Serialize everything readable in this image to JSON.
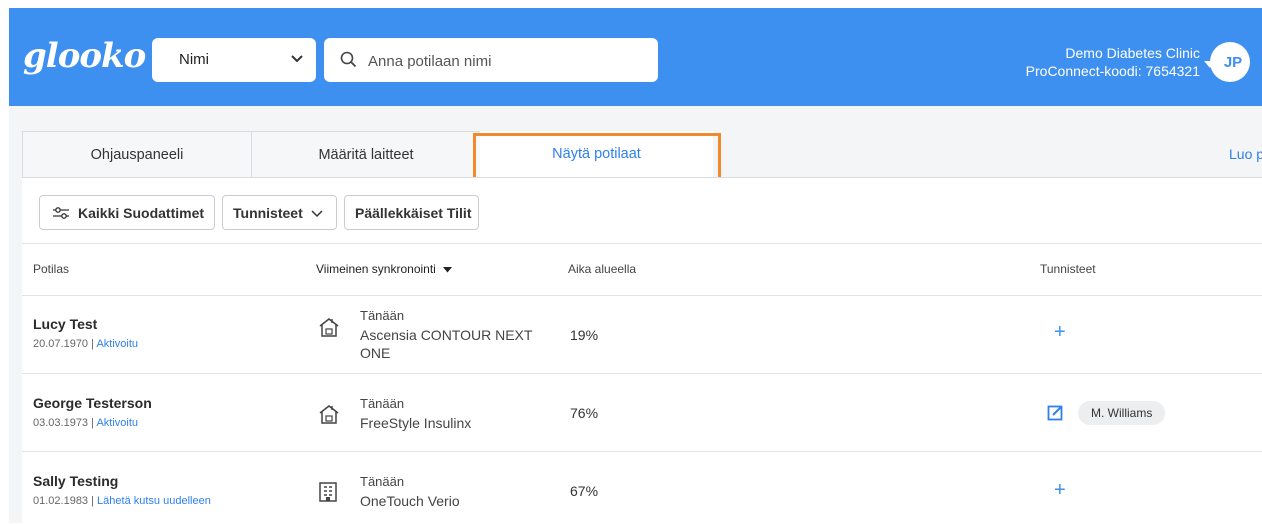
{
  "header": {
    "logo": "glooko",
    "search_type": "Nimi",
    "search_placeholder": "Anna potilaan nimi",
    "clinic_name": "Demo Diabetes Clinic",
    "proconnect_code": "ProConnect-koodi: 7654321",
    "avatar_initials": "JP"
  },
  "tabs": [
    {
      "label": "Ohjauspaneeli",
      "active": false
    },
    {
      "label": "Määritä laitteet",
      "active": false
    },
    {
      "label": "Näytä potilaat",
      "active": true
    }
  ],
  "top_right_link": "Luo p",
  "filters": {
    "all_filters": "Kaikki Suodattimet",
    "tags": "Tunnisteet",
    "duplicate_accounts": "Päällekkäiset Tilit"
  },
  "table": {
    "columns": {
      "patient": "Potilas",
      "last_sync": "Viimeinen synkronointi",
      "time_in_range": "Aika alueella",
      "tags": "Tunnisteet"
    },
    "rows": [
      {
        "name": "Lucy Test",
        "dob": "20.07.1970",
        "status": "Aktivoitu",
        "sync_day": "Tänään",
        "device": "Ascensia CONTOUR NEXT ONE",
        "device_icon": "home-device-icon",
        "time_in_range": "19%",
        "tag": ""
      },
      {
        "name": "George Testerson",
        "dob": "03.03.1973",
        "status": "Aktivoitu",
        "sync_day": "Tänään",
        "device": "FreeStyle Insulinx",
        "device_icon": "home-device-icon",
        "time_in_range": "76%",
        "tag": "M. Williams"
      },
      {
        "name": "Sally Testing",
        "dob": "01.02.1983",
        "status": "Lähetä kutsu uudelleen",
        "sync_day": "Tänään",
        "device": "OneTouch Verio",
        "device_icon": "clinic-building-icon",
        "time_in_range": "67%",
        "tag": ""
      }
    ]
  },
  "colors": {
    "brand_blue": "#3d8ff0",
    "link_blue": "#2f80ed",
    "highlight_orange": "#f28a2c"
  }
}
